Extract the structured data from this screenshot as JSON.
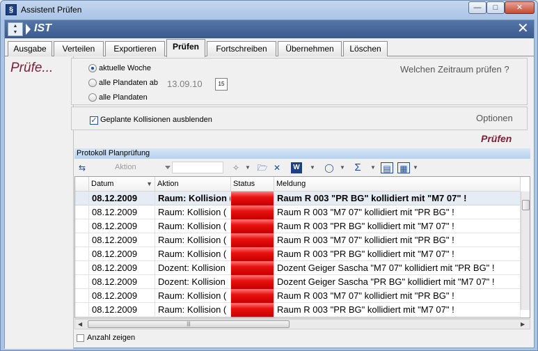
{
  "window": {
    "title": "Assistent Prüfen",
    "app_icon_glyph": "§"
  },
  "header": {
    "title": "IST"
  },
  "tabs": [
    {
      "label": "Ausgabe"
    },
    {
      "label": "Verteilen"
    },
    {
      "label": "Exportieren"
    },
    {
      "label": "Prüfen"
    },
    {
      "label": "Fortschreiben"
    },
    {
      "label": "Übernehmen"
    },
    {
      "label": "Löschen"
    }
  ],
  "left": {
    "title": "Prüfe..."
  },
  "period": {
    "heading": "Welchen Zeitraum prüfen ?",
    "options": [
      {
        "label": "aktuelle Woche"
      },
      {
        "label": "alle Plandaten ab"
      },
      {
        "label": "alle Plandaten"
      }
    ],
    "selected": "aktuelle Woche",
    "date_value": "13.09.10",
    "calendar_glyph": "15"
  },
  "options": {
    "heading": "Optionen",
    "hide_collisions_label": "Geplante Kollisionen ausblenden",
    "hide_collisions_checked": true
  },
  "action": {
    "label": "Prüfen"
  },
  "protocol": {
    "title": "Protokoll Planprüfung",
    "filter_label": "Aktion",
    "columns": [
      "Datum",
      "Aktion",
      "Status",
      "Meldung"
    ],
    "rows": [
      {
        "datum": "08.12.2009",
        "aktion": "Raum: Kollision (",
        "meldung": "Raum R 003 \"PR BG\" kollidiert mit \"M7 07\" !"
      },
      {
        "datum": "08.12.2009",
        "aktion": "Raum: Kollision (",
        "meldung": "Raum R 003 \"M7 07\" kollidiert mit \"PR BG\" !"
      },
      {
        "datum": "08.12.2009",
        "aktion": "Raum: Kollision (",
        "meldung": "Raum R 003 \"PR BG\" kollidiert mit \"M7 07\" !"
      },
      {
        "datum": "08.12.2009",
        "aktion": "Raum: Kollision (",
        "meldung": "Raum R 003 \"M7 07\" kollidiert mit \"PR BG\" !"
      },
      {
        "datum": "08.12.2009",
        "aktion": "Raum: Kollision (",
        "meldung": "Raum R 003 \"PR BG\" kollidiert mit \"M7 07\" !"
      },
      {
        "datum": "08.12.2009",
        "aktion": "Dozent: Kollision",
        "meldung": "Dozent Geiger Sascha \"M7 07\" kollidiert mit \"PR BG\" !"
      },
      {
        "datum": "08.12.2009",
        "aktion": "Dozent: Kollision",
        "meldung": "Dozent Geiger Sascha \"PR BG\" kollidiert mit \"M7 07\" !"
      },
      {
        "datum": "08.12.2009",
        "aktion": "Raum: Kollision (",
        "meldung": "Raum R 003 \"M7 07\" kollidiert mit \"PR BG\" !"
      },
      {
        "datum": "08.12.2009",
        "aktion": "Raum: Kollision (",
        "meldung": "Raum R 003 \"PR BG\" kollidiert mit \"M7 07\" !"
      }
    ],
    "status_color": "#e81010",
    "selected_row": 0,
    "show_count_label": "Anzahl zeigen"
  }
}
